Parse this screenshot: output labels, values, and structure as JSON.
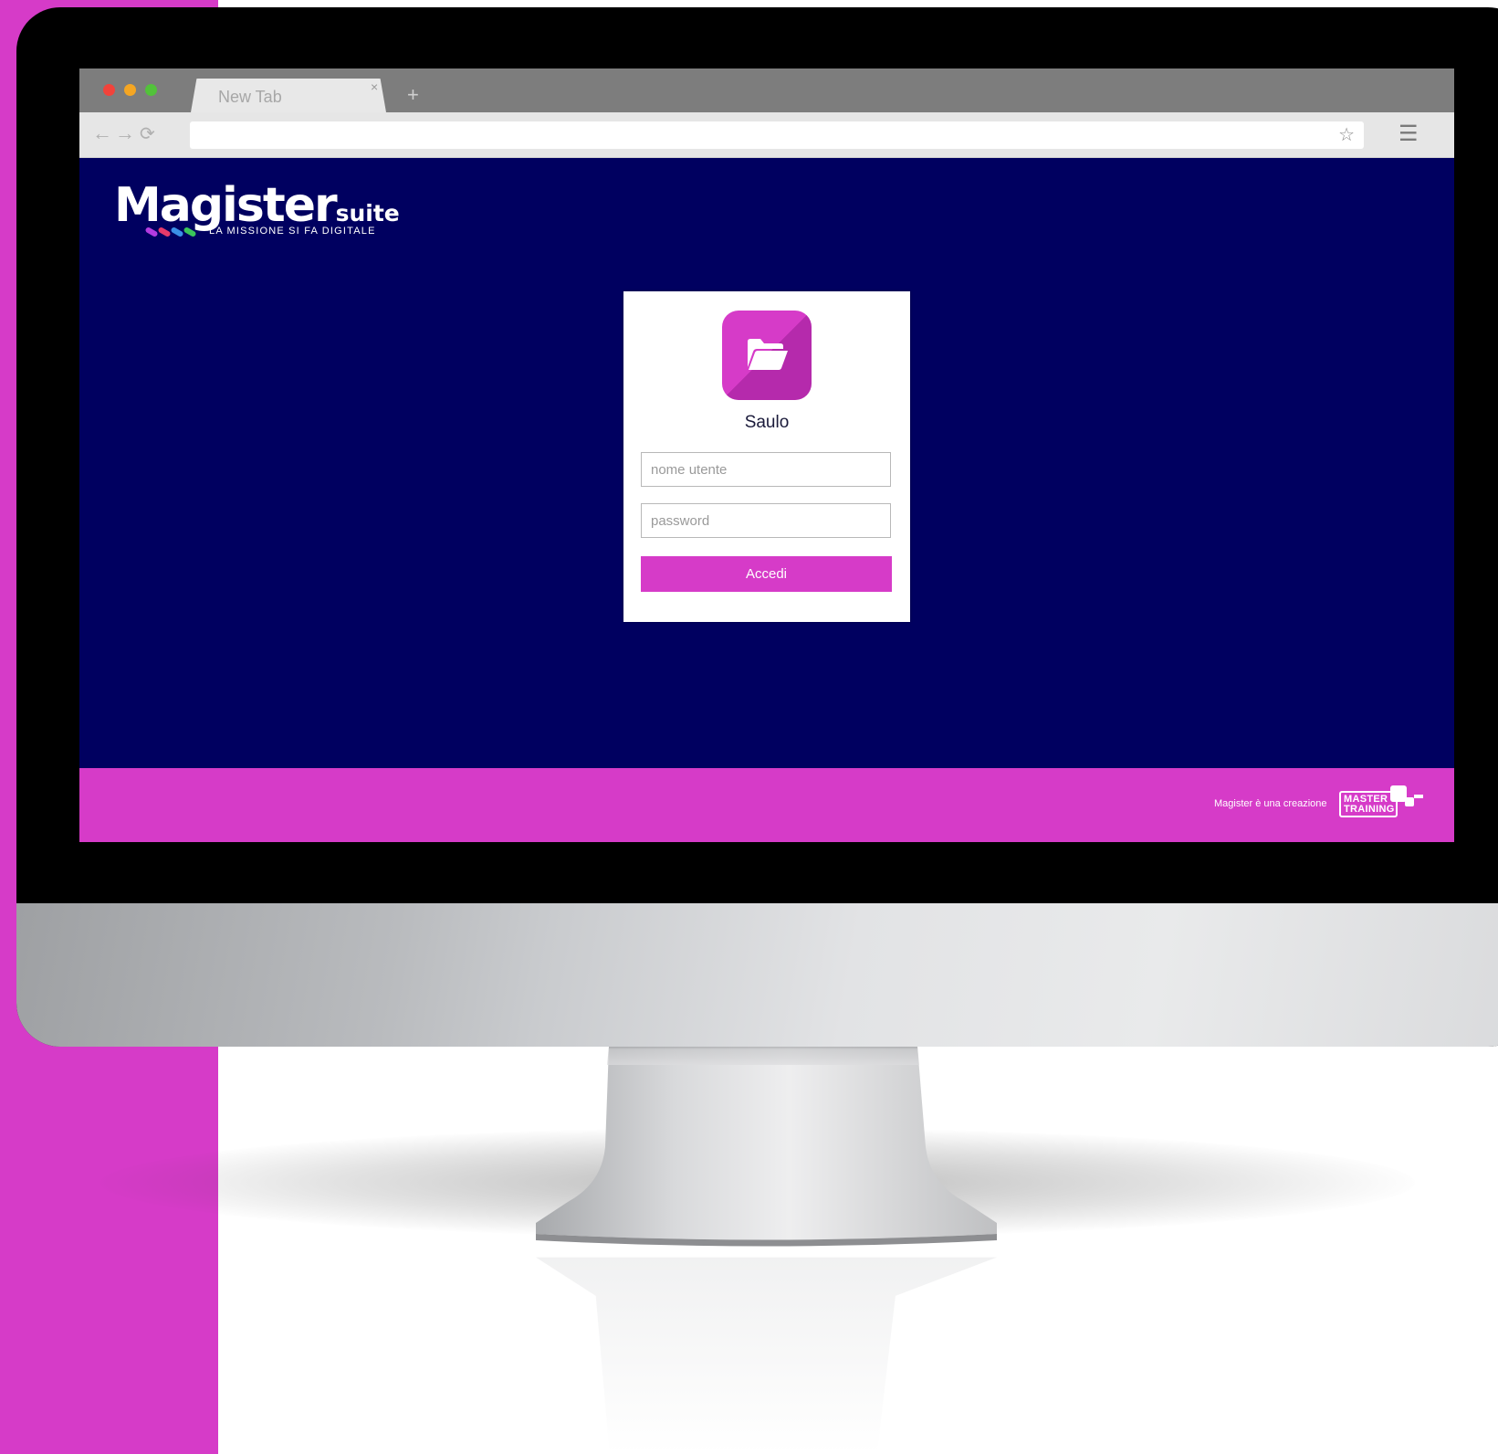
{
  "browser": {
    "tab_title": "New Tab",
    "tab_close": "×",
    "new_tab": "+",
    "url": "",
    "nav": {
      "back": "←",
      "forward": "→",
      "reload": "⟳"
    },
    "star": "☆",
    "menu": "☰"
  },
  "logo": {
    "main": "Magister",
    "suite": "suite",
    "tagline": "LA MISSIONE SI FA DIGITALE"
  },
  "login": {
    "app_name": "Saulo",
    "username_placeholder": "nome utente",
    "password_placeholder": "password",
    "submit_label": "Accedi"
  },
  "footer": {
    "credit_text": "Magister è una creazione",
    "partner_line1": "MASTER",
    "partner_line2": "TRAINING"
  },
  "colors": {
    "accent": "#d63bc8",
    "page_background": "#000060",
    "card_background": "#ffffff"
  }
}
